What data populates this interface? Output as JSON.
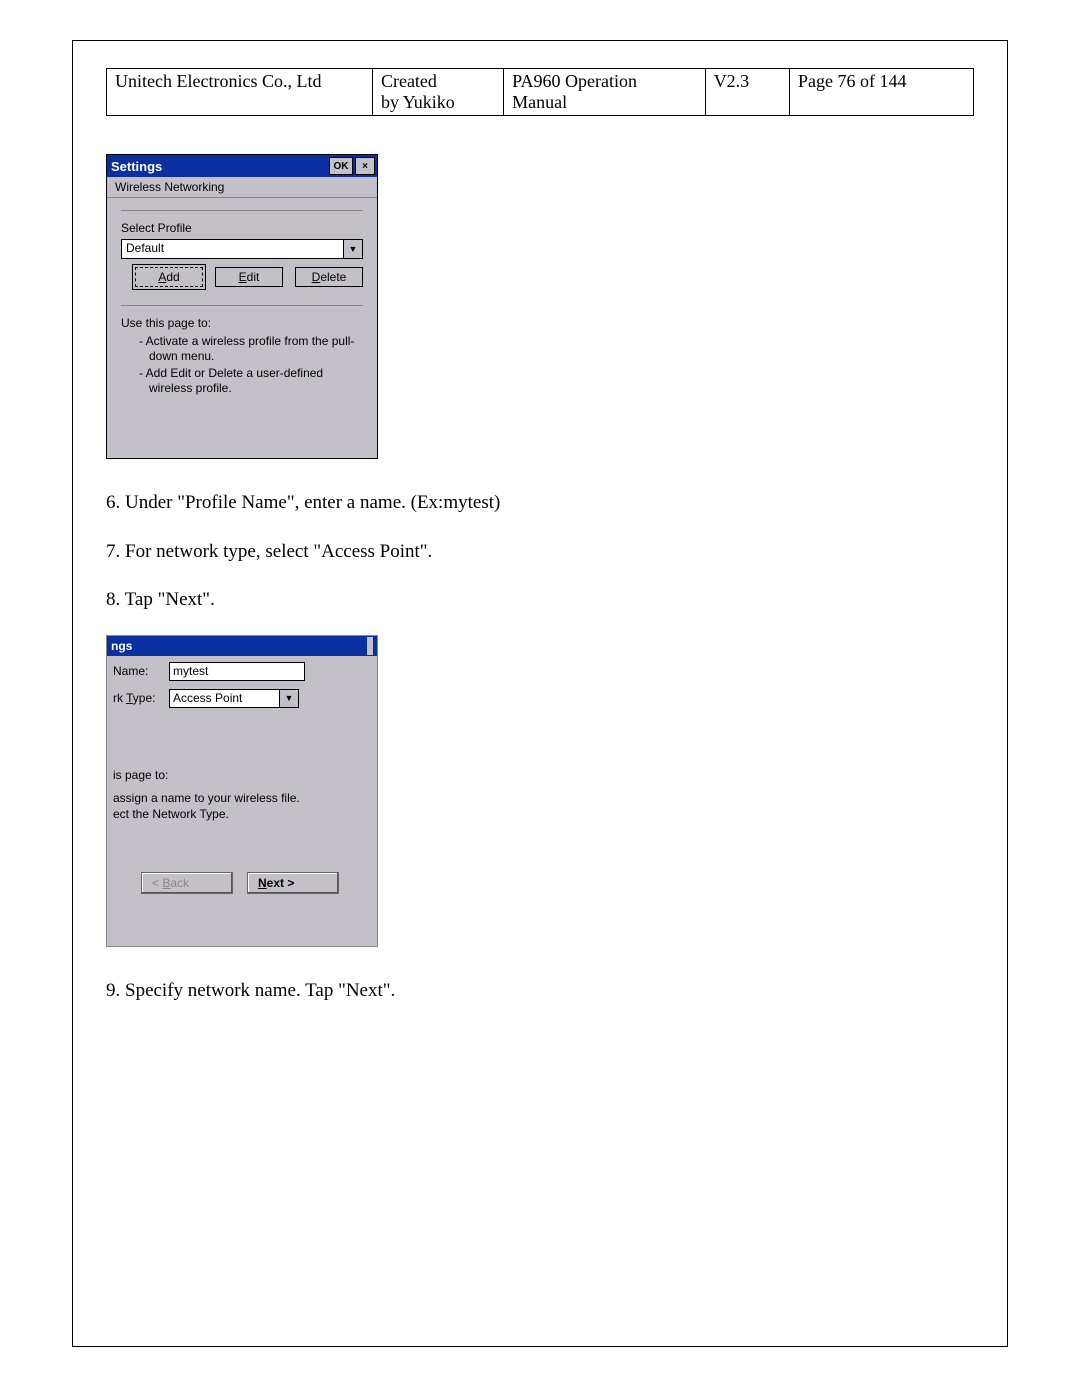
{
  "header": {
    "company": "Unitech Electronics Co., Ltd",
    "created_line1": "Created",
    "created_line2": "by Yukiko",
    "manual_line1": "PA960 Operation",
    "manual_line2": "Manual",
    "version": "V2.3",
    "page": "Page 76 of 144"
  },
  "shot1": {
    "title": "Settings",
    "ok": "OK",
    "close": "×",
    "tab": "Wireless Networking",
    "select_label": "Select Profile",
    "select_value": "Default",
    "add": "Add",
    "edit": "Edit",
    "delete": "Delete",
    "help_title": "Use this page to:",
    "help1": "-  Activate a wireless profile from the pull-down menu.",
    "help2": "-  Add Edit or Delete a user-defined wireless profile."
  },
  "steps": {
    "s6": "6. Under \"Profile Name\", enter a name. (Ex:mytest)",
    "s7": "7. For network type, select \"Access Point\".",
    "s8": "8. Tap \"Next\".",
    "s9": "9. Specify network name. Tap \"Next\"."
  },
  "shot2": {
    "title_frag": "ngs",
    "name_label": "Name:",
    "name_value": "mytest",
    "type_label": "rk Type:",
    "type_value": "Access Point",
    "mid1": "is page to:",
    "mid2": "assign a name to your wireless file.",
    "mid3": "ect the Network Type.",
    "back": "< Back",
    "next": "Next >"
  }
}
